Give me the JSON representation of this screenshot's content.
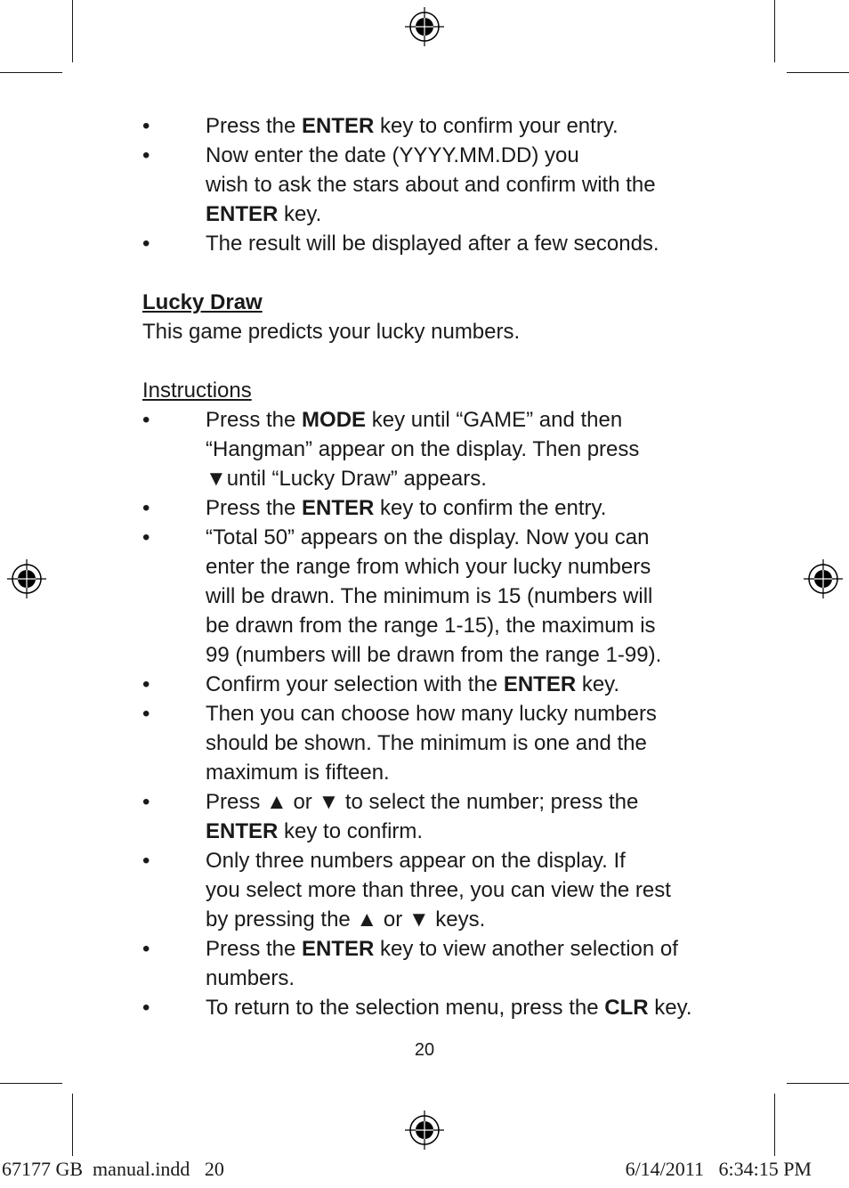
{
  "page": {
    "lines": [
      {
        "bullet": true,
        "parts": [
          [
            "Press the ",
            false
          ],
          [
            "ENTER",
            true
          ],
          [
            " key to confirm your entry.",
            false
          ]
        ]
      },
      {
        "bullet": true,
        "parts": [
          [
            "Now enter the date (YYYY.MM.DD) you",
            false
          ]
        ]
      },
      {
        "bullet": false,
        "indent": true,
        "parts": [
          [
            "wish to ask the stars about and confirm with the",
            false
          ]
        ]
      },
      {
        "bullet": false,
        "indent": true,
        "parts": [
          [
            "ENTER",
            true
          ],
          [
            " key.",
            false
          ]
        ]
      },
      {
        "bullet": true,
        "parts": [
          [
            "The result will be displayed after a few seconds.",
            false
          ]
        ]
      },
      {
        "blank": true
      },
      {
        "heading": "Lucky Draw",
        "bold": true
      },
      {
        "plain": "This game predicts your lucky numbers."
      },
      {
        "blank": true
      },
      {
        "heading": "Instructions",
        "bold": false
      },
      {
        "bullet": true,
        "parts": [
          [
            "Press the ",
            false
          ],
          [
            "MODE",
            true
          ],
          [
            " key until “GAME” and then",
            false
          ]
        ]
      },
      {
        "bullet": false,
        "indent": true,
        "parts": [
          [
            "“Hangman” appear on the display. Then press",
            false
          ]
        ]
      },
      {
        "bullet": false,
        "indent": true,
        "parts": [
          [
            "▼until “Lucky Draw” appears.",
            false
          ]
        ]
      },
      {
        "bullet": true,
        "parts": [
          [
            "Press the ",
            false
          ],
          [
            "ENTER",
            true
          ],
          [
            " key to confirm the entry.",
            false
          ]
        ]
      },
      {
        "bullet": true,
        "parts": [
          [
            "“Total 50” appears on the display. Now you can",
            false
          ]
        ]
      },
      {
        "bullet": false,
        "indent": true,
        "parts": [
          [
            "enter the range from which your lucky numbers",
            false
          ]
        ]
      },
      {
        "bullet": false,
        "indent": true,
        "parts": [
          [
            "will be drawn. The minimum is 15 (numbers will",
            false
          ]
        ]
      },
      {
        "bullet": false,
        "indent": true,
        "parts": [
          [
            "be drawn from the range 1-15), the maximum is",
            false
          ]
        ]
      },
      {
        "bullet": false,
        "indent": true,
        "parts": [
          [
            "99 (numbers will be drawn from the range 1-99).",
            false
          ]
        ]
      },
      {
        "bullet": true,
        "parts": [
          [
            "Confirm your selection with the ",
            false
          ],
          [
            "ENTER",
            true
          ],
          [
            " key.",
            false
          ]
        ]
      },
      {
        "bullet": true,
        "parts": [
          [
            "Then you can choose how many lucky numbers",
            false
          ]
        ]
      },
      {
        "bullet": false,
        "indent": true,
        "parts": [
          [
            "should be shown. The minimum is one and the",
            false
          ]
        ]
      },
      {
        "bullet": false,
        "indent": true,
        "parts": [
          [
            "maximum is fifteen.",
            false
          ]
        ]
      },
      {
        "bullet": true,
        "parts": [
          [
            "Press ▲ or ▼ to select the number; press the",
            false
          ]
        ]
      },
      {
        "bullet": false,
        "indent": true,
        "parts": [
          [
            "ENTER",
            true
          ],
          [
            " key to confirm.",
            false
          ]
        ]
      },
      {
        "bullet": true,
        "parts": [
          [
            "Only three numbers appear on the display. If",
            false
          ]
        ]
      },
      {
        "bullet": false,
        "indent": true,
        "parts": [
          [
            "you select more than three, you can view the rest",
            false
          ]
        ]
      },
      {
        "bullet": false,
        "indent": true,
        "parts": [
          [
            "by pressing the ▲ or ▼ keys.",
            false
          ]
        ]
      },
      {
        "bullet": true,
        "parts": [
          [
            "Press the ",
            false
          ],
          [
            "ENTER",
            true
          ],
          [
            " key to view another selection of",
            false
          ]
        ]
      },
      {
        "bullet": false,
        "indent": true,
        "parts": [
          [
            "numbers.",
            false
          ]
        ]
      },
      {
        "bullet": true,
        "parts": [
          [
            "To return to the selection menu, press the ",
            false
          ],
          [
            "CLR",
            true
          ],
          [
            " key.",
            false
          ]
        ]
      }
    ],
    "bullet_char": "•",
    "page_number": "20",
    "slug_left": "67177 GB  manual.indd   20",
    "slug_right": "6/14/2011   6:34:15 PM"
  },
  "icons": [
    "registration-mark-icon"
  ]
}
